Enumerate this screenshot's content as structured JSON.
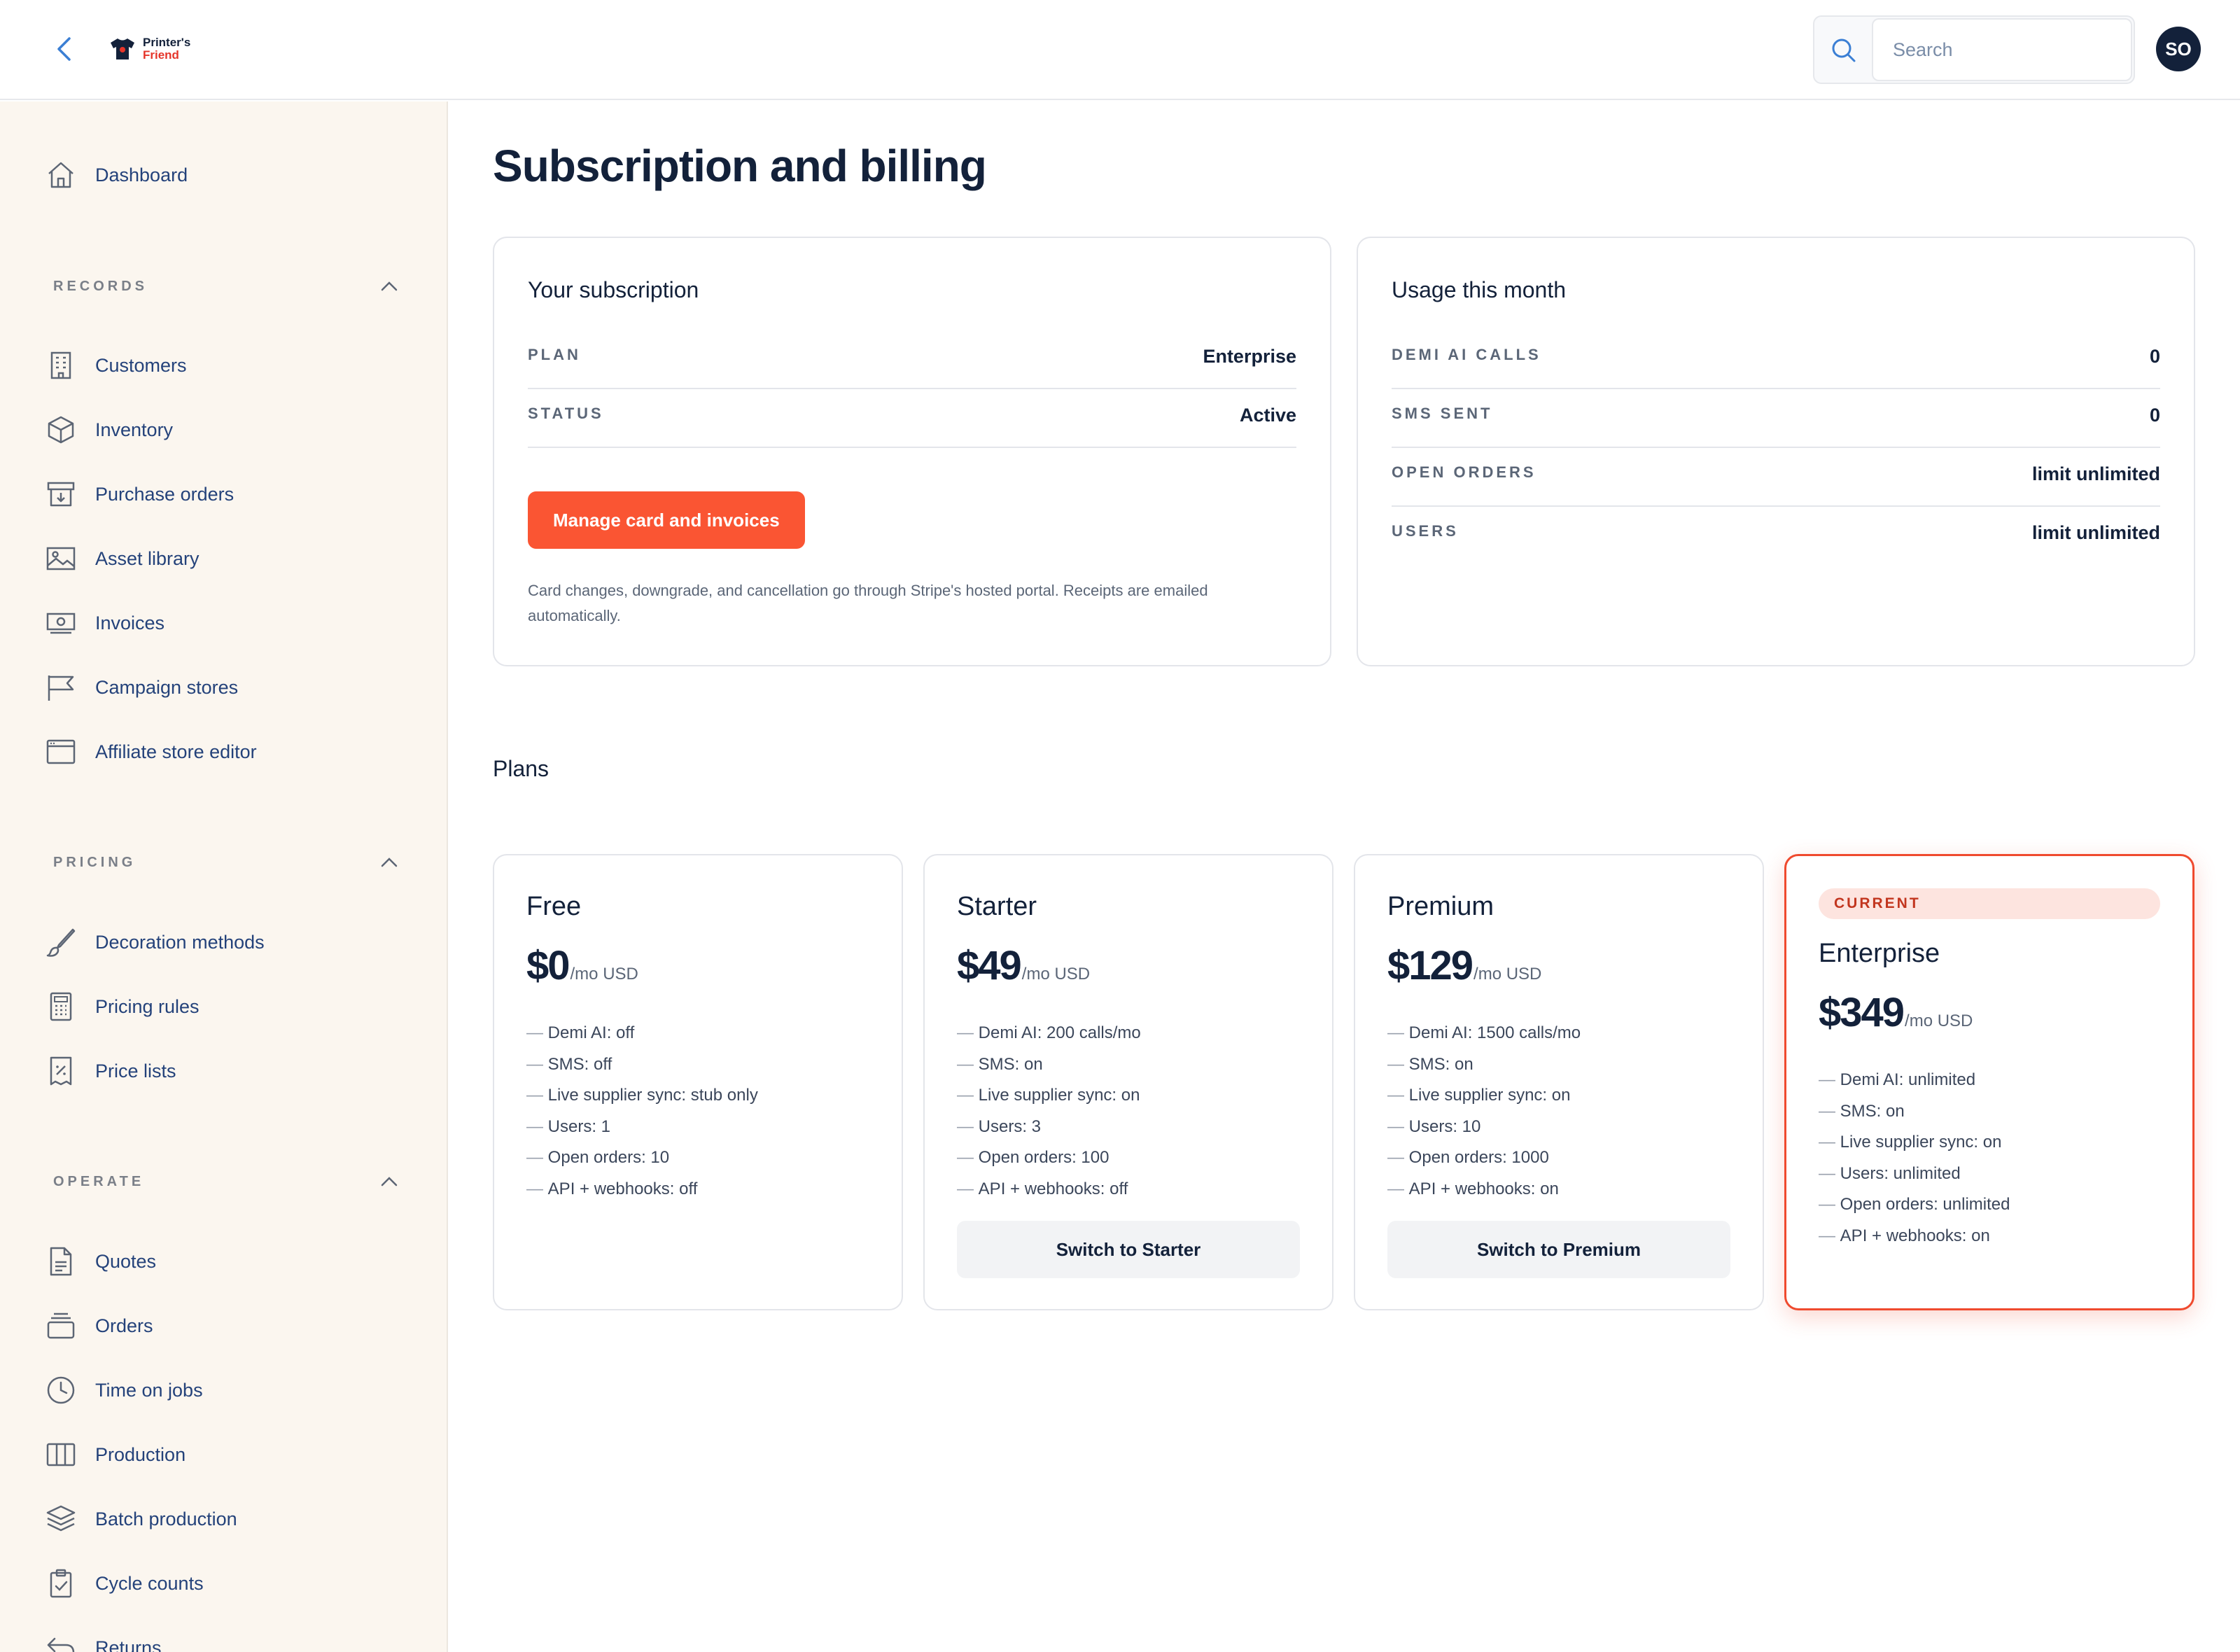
{
  "header": {
    "logo_line1": "Printer's",
    "logo_line2": "Friend",
    "search_placeholder": "Search",
    "avatar_initials": "SO"
  },
  "sidebar": {
    "dashboard": "Dashboard",
    "sections": [
      {
        "label": "RECORDS",
        "items": [
          "Customers",
          "Inventory",
          "Purchase orders",
          "Asset library",
          "Invoices",
          "Campaign stores",
          "Affiliate store editor"
        ]
      },
      {
        "label": "PRICING",
        "items": [
          "Decoration methods",
          "Pricing rules",
          "Price lists"
        ]
      },
      {
        "label": "OPERATE",
        "items": [
          "Quotes",
          "Orders",
          "Time on jobs",
          "Production",
          "Batch production",
          "Cycle counts",
          "Returns"
        ]
      }
    ]
  },
  "page": {
    "title": "Subscription and billing"
  },
  "subscription": {
    "title": "Your subscription",
    "rows": [
      {
        "label": "PLAN",
        "value": "Enterprise"
      },
      {
        "label": "STATUS",
        "value": "Active"
      }
    ],
    "manage_button": "Manage card and invoices",
    "note": "Card changes, downgrade, and cancellation go through Stripe's hosted portal. Receipts are emailed automatically."
  },
  "usage": {
    "title": "Usage this month",
    "rows": [
      {
        "label": "DEMI AI CALLS",
        "value": "0"
      },
      {
        "label": "SMS SENT",
        "value": "0"
      },
      {
        "label": "OPEN ORDERS",
        "value": "limit unlimited"
      },
      {
        "label": "USERS",
        "value": "limit unlimited"
      }
    ]
  },
  "plans": {
    "title": "Plans",
    "items": [
      {
        "name": "Free",
        "price": "$0",
        "unit": "/mo USD",
        "features": [
          "Demi AI: off",
          "SMS: off",
          "Live supplier sync: stub only",
          "Users: 1",
          "Open orders: 10",
          "API + webhooks: off"
        ]
      },
      {
        "name": "Starter",
        "price": "$49",
        "unit": "/mo USD",
        "features": [
          "Demi AI: 200 calls/mo",
          "SMS: on",
          "Live supplier sync: on",
          "Users: 3",
          "Open orders: 100",
          "API + webhooks: off"
        ],
        "button": "Switch to Starter"
      },
      {
        "name": "Premium",
        "price": "$129",
        "unit": "/mo USD",
        "features": [
          "Demi AI: 1500 calls/mo",
          "SMS: on",
          "Live supplier sync: on",
          "Users: 10",
          "Open orders: 1000",
          "API + webhooks: on"
        ],
        "button": "Switch to Premium"
      },
      {
        "name": "Enterprise",
        "price": "$349",
        "unit": "/mo USD",
        "badge": "CURRENT",
        "features": [
          "Demi AI: unlimited",
          "SMS: on",
          "Live supplier sync: on",
          "Users: unlimited",
          "Open orders: unlimited",
          "API + webhooks: on"
        ]
      }
    ]
  },
  "colors": {
    "accent": "#fa5533",
    "sidebar_bg": "#fbf6ef",
    "nav_text": "#24427a",
    "heading": "#13213a",
    "current_border": "#ef4a2e"
  }
}
